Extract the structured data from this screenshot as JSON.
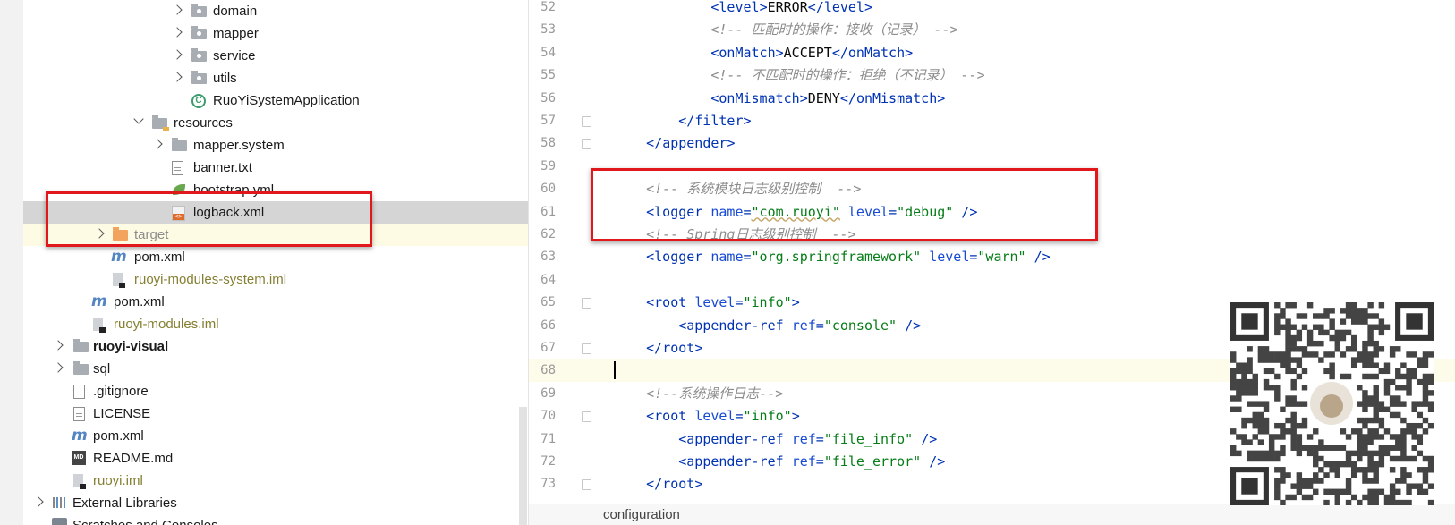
{
  "project_tree": {
    "items": [
      {
        "label": "domain",
        "icon": "package-folder-icon",
        "arrow": "collapsed"
      },
      {
        "label": "mapper",
        "icon": "package-folder-icon",
        "arrow": "collapsed"
      },
      {
        "label": "service",
        "icon": "package-folder-icon",
        "arrow": "collapsed"
      },
      {
        "label": "utils",
        "icon": "package-folder-icon",
        "arrow": "collapsed"
      },
      {
        "label": "RuoYiSystemApplication",
        "icon": "spring-boot-class-icon"
      },
      {
        "label": "resources",
        "icon": "resources-folder-icon",
        "arrow": "expanded"
      },
      {
        "label": "mapper.system",
        "icon": "folder-icon",
        "arrow": "collapsed"
      },
      {
        "label": "banner.txt",
        "icon": "text-file-icon"
      },
      {
        "label": "bootstrap.yml",
        "icon": "yaml-file-icon"
      },
      {
        "label": "logback.xml",
        "icon": "xml-file-icon",
        "selected": true
      },
      {
        "label": "target",
        "icon": "excluded-folder-icon",
        "arrow": "collapsed"
      },
      {
        "label": "pom.xml",
        "icon": "maven-icon"
      },
      {
        "label": "ruoyi-modules-system.iml",
        "icon": "iml-file-icon"
      },
      {
        "label": "pom.xml",
        "icon": "maven-icon"
      },
      {
        "label": "ruoyi-modules.iml",
        "icon": "iml-file-icon"
      },
      {
        "label": "ruoyi-visual",
        "icon": "module-folder-icon",
        "arrow": "collapsed"
      },
      {
        "label": "sql",
        "icon": "folder-icon",
        "arrow": "collapsed"
      },
      {
        "label": ".gitignore",
        "icon": "gitignore-file-icon"
      },
      {
        "label": "LICENSE",
        "icon": "text-file-icon"
      },
      {
        "label": "pom.xml",
        "icon": "maven-icon"
      },
      {
        "label": "README.md",
        "icon": "markdown-file-icon"
      },
      {
        "label": "ruoyi.iml",
        "icon": "iml-file-icon"
      },
      {
        "label": "External Libraries",
        "icon": "libraries-icon",
        "arrow": "collapsed"
      },
      {
        "label": "Scratches and Consoles",
        "icon": "scratches-icon"
      }
    ]
  },
  "editor": {
    "lines": [
      {
        "no": "52",
        "tokens": [
          [
            "t",
            "            "
          ],
          [
            "p",
            "<"
          ],
          [
            "g",
            "level"
          ],
          [
            "p",
            ">"
          ],
          [
            "t",
            "ERROR"
          ],
          [
            "p",
            "</"
          ],
          [
            "g",
            "level"
          ],
          [
            "p",
            ">"
          ]
        ]
      },
      {
        "no": "53",
        "tokens": [
          [
            "t",
            "            "
          ],
          [
            "c",
            "<!-- 匹配时的操作：接收（记录） -->"
          ]
        ]
      },
      {
        "no": "54",
        "tokens": [
          [
            "t",
            "            "
          ],
          [
            "p",
            "<"
          ],
          [
            "g",
            "onMatch"
          ],
          [
            "p",
            ">"
          ],
          [
            "t",
            "ACCEPT"
          ],
          [
            "p",
            "</"
          ],
          [
            "g",
            "onMatch"
          ],
          [
            "p",
            ">"
          ]
        ]
      },
      {
        "no": "55",
        "tokens": [
          [
            "t",
            "            "
          ],
          [
            "c",
            "<!-- 不匹配时的操作：拒绝（不记录） -->"
          ]
        ]
      },
      {
        "no": "56",
        "tokens": [
          [
            "t",
            "            "
          ],
          [
            "p",
            "<"
          ],
          [
            "g",
            "onMismatch"
          ],
          [
            "p",
            ">"
          ],
          [
            "t",
            "DENY"
          ],
          [
            "p",
            "</"
          ],
          [
            "g",
            "onMismatch"
          ],
          [
            "p",
            ">"
          ]
        ]
      },
      {
        "no": "57",
        "tokens": [
          [
            "t",
            "        "
          ],
          [
            "p",
            "</"
          ],
          [
            "g",
            "filter"
          ],
          [
            "p",
            ">"
          ]
        ]
      },
      {
        "no": "58",
        "tokens": [
          [
            "t",
            "    "
          ],
          [
            "p",
            "</"
          ],
          [
            "g",
            "appender"
          ],
          [
            "p",
            ">"
          ]
        ]
      },
      {
        "no": "59",
        "tokens": []
      },
      {
        "no": "60",
        "tokens": [
          [
            "t",
            "    "
          ],
          [
            "c",
            "<!-- 系统模块日志级别控制  -->"
          ]
        ]
      },
      {
        "no": "61",
        "tokens": [
          [
            "t",
            "    "
          ],
          [
            "p",
            "<"
          ],
          [
            "g",
            "logger "
          ],
          [
            "a",
            "name"
          ],
          [
            "p",
            "="
          ],
          [
            "s",
            "\"com.ruoyi\""
          ],
          [
            "t",
            " "
          ],
          [
            "a",
            "level"
          ],
          [
            "p",
            "="
          ],
          [
            "s",
            "\"debug\""
          ],
          [
            "t",
            " "
          ],
          [
            "p",
            "/>"
          ]
        ]
      },
      {
        "no": "62",
        "tokens": [
          [
            "t",
            "    "
          ],
          [
            "c",
            "<!-- Spring日志级别控制  -->"
          ]
        ]
      },
      {
        "no": "63",
        "tokens": [
          [
            "t",
            "    "
          ],
          [
            "p",
            "<"
          ],
          [
            "g",
            "logger "
          ],
          [
            "a",
            "name"
          ],
          [
            "p",
            "="
          ],
          [
            "s",
            "\"org.springframework\""
          ],
          [
            "t",
            " "
          ],
          [
            "a",
            "level"
          ],
          [
            "p",
            "="
          ],
          [
            "s",
            "\"warn\""
          ],
          [
            "t",
            " "
          ],
          [
            "p",
            "/>"
          ]
        ]
      },
      {
        "no": "64",
        "tokens": []
      },
      {
        "no": "65",
        "tokens": [
          [
            "t",
            "    "
          ],
          [
            "p",
            "<"
          ],
          [
            "g",
            "root "
          ],
          [
            "a",
            "level"
          ],
          [
            "p",
            "="
          ],
          [
            "s",
            "\"info\""
          ],
          [
            "p",
            ">"
          ]
        ]
      },
      {
        "no": "66",
        "tokens": [
          [
            "t",
            "        "
          ],
          [
            "p",
            "<"
          ],
          [
            "g",
            "appender-ref "
          ],
          [
            "a",
            "ref"
          ],
          [
            "p",
            "="
          ],
          [
            "s",
            "\"console\""
          ],
          [
            "t",
            " "
          ],
          [
            "p",
            "/>"
          ]
        ]
      },
      {
        "no": "67",
        "tokens": [
          [
            "t",
            "    "
          ],
          [
            "p",
            "</"
          ],
          [
            "g",
            "root"
          ],
          [
            "p",
            ">"
          ]
        ]
      },
      {
        "no": "68",
        "tokens": []
      },
      {
        "no": "69",
        "tokens": [
          [
            "t",
            "    "
          ],
          [
            "c",
            "<!--系统操作日志-->"
          ]
        ]
      },
      {
        "no": "70",
        "tokens": [
          [
            "t",
            "    "
          ],
          [
            "p",
            "<"
          ],
          [
            "g",
            "root "
          ],
          [
            "a",
            "level"
          ],
          [
            "p",
            "="
          ],
          [
            "s",
            "\"info\""
          ],
          [
            "p",
            ">"
          ]
        ]
      },
      {
        "no": "71",
        "tokens": [
          [
            "t",
            "        "
          ],
          [
            "p",
            "<"
          ],
          [
            "g",
            "appender-ref "
          ],
          [
            "a",
            "ref"
          ],
          [
            "p",
            "="
          ],
          [
            "s",
            "\"file_info\""
          ],
          [
            "t",
            " "
          ],
          [
            "p",
            "/>"
          ]
        ]
      },
      {
        "no": "72",
        "tokens": [
          [
            "t",
            "        "
          ],
          [
            "p",
            "<"
          ],
          [
            "g",
            "appender-ref "
          ],
          [
            "a",
            "ref"
          ],
          [
            "p",
            "="
          ],
          [
            "s",
            "\"file_error\""
          ],
          [
            "t",
            " "
          ],
          [
            "p",
            "/>"
          ]
        ]
      },
      {
        "no": "73",
        "tokens": [
          [
            "t",
            "    "
          ],
          [
            "p",
            "</"
          ],
          [
            "g",
            "root"
          ],
          [
            "p",
            ">"
          ]
        ]
      }
    ],
    "current_line": "68",
    "breadcrumb": "configuration"
  },
  "colors": {
    "annotation_box": "#e0181b",
    "xml_tag": "#0033b3",
    "xml_attribute": "#174ad4",
    "xml_string": "#067d17",
    "xml_comment": "#8c8c8c",
    "selection": "#d5d5d5"
  },
  "overlays": {
    "annotations": [
      "red-box-logback-file",
      "red-box-logger-config"
    ],
    "qr_code": "qr-code-icon"
  }
}
